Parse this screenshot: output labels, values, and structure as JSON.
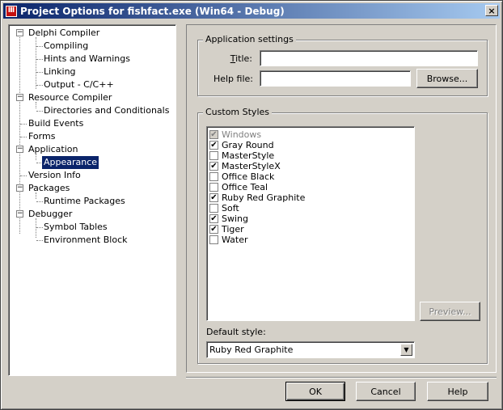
{
  "window": {
    "title": "Project Options for fishfact.exe  (Win64 - Debug)",
    "icon": "delphi-app-icon",
    "close_label": "×"
  },
  "tree": {
    "items": [
      {
        "label": "Delphi Compiler",
        "level": 0,
        "expander": "−"
      },
      {
        "label": "Compiling",
        "level": 1
      },
      {
        "label": "Hints and Warnings",
        "level": 1
      },
      {
        "label": "Linking",
        "level": 1
      },
      {
        "label": "Output - C/C++",
        "level": 1
      },
      {
        "label": "Resource Compiler",
        "level": 0,
        "expander": "−"
      },
      {
        "label": "Directories and Conditionals",
        "level": 1
      },
      {
        "label": "Build Events",
        "level": 0
      },
      {
        "label": "Forms",
        "level": 0
      },
      {
        "label": "Application",
        "level": 0,
        "expander": "−"
      },
      {
        "label": "Appearance",
        "level": 1,
        "selected": true
      },
      {
        "label": "Version Info",
        "level": 0
      },
      {
        "label": "Packages",
        "level": 0,
        "expander": "−"
      },
      {
        "label": "Runtime Packages",
        "level": 1
      },
      {
        "label": "Debugger",
        "level": 0,
        "expander": "−"
      },
      {
        "label": "Symbol Tables",
        "level": 1
      },
      {
        "label": "Environment Block",
        "level": 1
      }
    ]
  },
  "app_settings": {
    "group_title": "Application settings",
    "title_label": "Title:",
    "title_value": "",
    "helpfile_label": "Help file:",
    "helpfile_value": "",
    "browse_label": "Browse..."
  },
  "custom_styles": {
    "group_title": "Custom Styles",
    "items": [
      {
        "label": "Windows",
        "checked": true,
        "disabled": true
      },
      {
        "label": "Gray Round",
        "checked": true
      },
      {
        "label": "MasterStyle",
        "checked": false
      },
      {
        "label": "MasterStyleX",
        "checked": true
      },
      {
        "label": "Office Black",
        "checked": false
      },
      {
        "label": "Office Teal",
        "checked": false
      },
      {
        "label": "Ruby Red Graphite",
        "checked": true
      },
      {
        "label": "Soft",
        "checked": false
      },
      {
        "label": "Swing",
        "checked": true
      },
      {
        "label": "Tiger",
        "checked": true
      },
      {
        "label": "Water",
        "checked": false
      }
    ],
    "check_glyph": "✔",
    "preview_label": "Preview...",
    "default_style_label": "Default style:",
    "default_style_value": "Ruby Red Graphite",
    "dropdown_glyph": "▼"
  },
  "footer": {
    "ok_label": "OK",
    "cancel_label": "Cancel",
    "help_label": "Help"
  },
  "colors": {
    "title_gradient_start": "#0a246a",
    "title_gradient_end": "#a6caf0",
    "face": "#d4d0c8",
    "selection": "#0a246a"
  }
}
